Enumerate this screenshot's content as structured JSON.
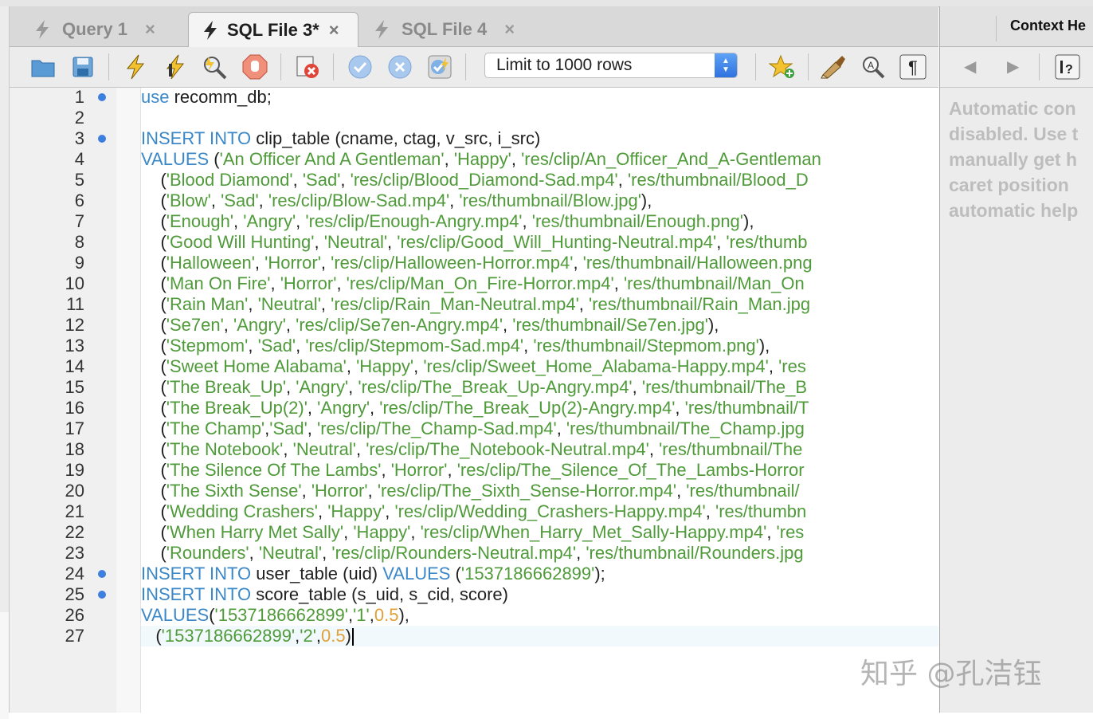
{
  "tabs": [
    {
      "label": "Query 1",
      "active": false
    },
    {
      "label": "SQL File 3*",
      "active": true
    },
    {
      "label": "SQL File 4",
      "active": false
    }
  ],
  "close_glyph": "×",
  "toolbar": {
    "limit_select": "Limit to 1000 rows",
    "icons": [
      "open-folder-icon",
      "save-icon",
      "execute-icon",
      "execute-current-icon",
      "explain-icon",
      "stop-icon",
      "toggle-stop-on-error-icon",
      "commit-icon",
      "rollback-icon",
      "autocommit-icon",
      "add-snippet-icon",
      "beautify-icon",
      "find-icon",
      "invisible-chars-icon"
    ]
  },
  "side_panel": {
    "title": "Context He",
    "message_lines": [
      "Automatic con",
      "disabled. Use t",
      "manually get h",
      "caret position",
      "automatic help"
    ]
  },
  "editor": {
    "lines": [
      {
        "n": "1",
        "dot": true,
        "indent": "",
        "parts": [
          [
            "kw",
            "use"
          ],
          [
            "t",
            " recomm_db;"
          ]
        ]
      },
      {
        "n": "2",
        "dot": false,
        "indent": "",
        "parts": []
      },
      {
        "n": "3",
        "dot": true,
        "indent": "",
        "parts": [
          [
            "kw",
            "INSERT INTO"
          ],
          [
            "t",
            " clip_table (cname, ctag, v_src, i_src)"
          ]
        ]
      },
      {
        "n": "4",
        "dot": false,
        "indent": "",
        "parts": [
          [
            "kw",
            "VALUES"
          ],
          [
            "t",
            " ("
          ],
          [
            "str",
            "'An Officer And A Gentleman'"
          ],
          [
            "t",
            ", "
          ],
          [
            "str",
            "'Happy'"
          ],
          [
            "t",
            ", "
          ],
          [
            "str",
            "'res/clip/An_Officer_And_A-Gentleman"
          ]
        ]
      },
      {
        "n": "5",
        "dot": false,
        "indent": "    ",
        "parts": [
          [
            "t",
            "("
          ],
          [
            "str",
            "'Blood Diamond'"
          ],
          [
            "t",
            ", "
          ],
          [
            "str",
            "'Sad'"
          ],
          [
            "t",
            ", "
          ],
          [
            "str",
            "'res/clip/Blood_Diamond-Sad.mp4'"
          ],
          [
            "t",
            ", "
          ],
          [
            "str",
            "'res/thumbnail/Blood_D"
          ]
        ]
      },
      {
        "n": "6",
        "dot": false,
        "indent": "    ",
        "parts": [
          [
            "t",
            "("
          ],
          [
            "str",
            "'Blow'"
          ],
          [
            "t",
            ", "
          ],
          [
            "str",
            "'Sad'"
          ],
          [
            "t",
            ", "
          ],
          [
            "str",
            "'res/clip/Blow-Sad.mp4'"
          ],
          [
            "t",
            ", "
          ],
          [
            "str",
            "'res/thumbnail/Blow.jpg'"
          ],
          [
            "t",
            "),"
          ]
        ]
      },
      {
        "n": "7",
        "dot": false,
        "indent": "    ",
        "parts": [
          [
            "t",
            "("
          ],
          [
            "str",
            "'Enough'"
          ],
          [
            "t",
            ", "
          ],
          [
            "str",
            "'Angry'"
          ],
          [
            "t",
            ", "
          ],
          [
            "str",
            "'res/clip/Enough-Angry.mp4'"
          ],
          [
            "t",
            ", "
          ],
          [
            "str",
            "'res/thumbnail/Enough.png'"
          ],
          [
            "t",
            "),"
          ]
        ]
      },
      {
        "n": "8",
        "dot": false,
        "indent": "    ",
        "parts": [
          [
            "t",
            "("
          ],
          [
            "str",
            "'Good Will Hunting'"
          ],
          [
            "t",
            ", "
          ],
          [
            "str",
            "'Neutral'"
          ],
          [
            "t",
            ", "
          ],
          [
            "str",
            "'res/clip/Good_Will_Hunting-Neutral.mp4'"
          ],
          [
            "t",
            ", "
          ],
          [
            "str",
            "'res/thumb"
          ]
        ]
      },
      {
        "n": "9",
        "dot": false,
        "indent": "    ",
        "parts": [
          [
            "t",
            "("
          ],
          [
            "str",
            "'Halloween'"
          ],
          [
            "t",
            ", "
          ],
          [
            "str",
            "'Horror'"
          ],
          [
            "t",
            ", "
          ],
          [
            "str",
            "'res/clip/Halloween-Horror.mp4'"
          ],
          [
            "t",
            ", "
          ],
          [
            "str",
            "'res/thumbnail/Halloween.png"
          ]
        ]
      },
      {
        "n": "10",
        "dot": false,
        "indent": "    ",
        "parts": [
          [
            "t",
            "("
          ],
          [
            "str",
            "'Man On Fire'"
          ],
          [
            "t",
            ", "
          ],
          [
            "str",
            "'Horror'"
          ],
          [
            "t",
            ", "
          ],
          [
            "str",
            "'res/clip/Man_On_Fire-Horror.mp4'"
          ],
          [
            "t",
            ", "
          ],
          [
            "str",
            "'res/thumbnail/Man_On"
          ]
        ]
      },
      {
        "n": "11",
        "dot": false,
        "indent": "    ",
        "parts": [
          [
            "t",
            "("
          ],
          [
            "str",
            "'Rain Man'"
          ],
          [
            "t",
            ", "
          ],
          [
            "str",
            "'Neutral'"
          ],
          [
            "t",
            ", "
          ],
          [
            "str",
            "'res/clip/Rain_Man-Neutral.mp4'"
          ],
          [
            "t",
            ", "
          ],
          [
            "str",
            "'res/thumbnail/Rain_Man.jpg"
          ]
        ]
      },
      {
        "n": "12",
        "dot": false,
        "indent": "    ",
        "parts": [
          [
            "t",
            "("
          ],
          [
            "str",
            "'Se7en'"
          ],
          [
            "t",
            ", "
          ],
          [
            "str",
            "'Angry'"
          ],
          [
            "t",
            ", "
          ],
          [
            "str",
            "'res/clip/Se7en-Angry.mp4'"
          ],
          [
            "t",
            ", "
          ],
          [
            "str",
            "'res/thumbnail/Se7en.jpg'"
          ],
          [
            "t",
            "),"
          ]
        ]
      },
      {
        "n": "13",
        "dot": false,
        "indent": "    ",
        "parts": [
          [
            "t",
            "("
          ],
          [
            "str",
            "'Stepmom'"
          ],
          [
            "t",
            ", "
          ],
          [
            "str",
            "'Sad'"
          ],
          [
            "t",
            ", "
          ],
          [
            "str",
            "'res/clip/Stepmom-Sad.mp4'"
          ],
          [
            "t",
            ", "
          ],
          [
            "str",
            "'res/thumbnail/Stepmom.png'"
          ],
          [
            "t",
            "),"
          ]
        ]
      },
      {
        "n": "14",
        "dot": false,
        "indent": "    ",
        "parts": [
          [
            "t",
            "("
          ],
          [
            "str",
            "'Sweet Home Alabama'"
          ],
          [
            "t",
            ", "
          ],
          [
            "str",
            "'Happy'"
          ],
          [
            "t",
            ", "
          ],
          [
            "str",
            "'res/clip/Sweet_Home_Alabama-Happy.mp4'"
          ],
          [
            "t",
            ", "
          ],
          [
            "str",
            "'res"
          ]
        ]
      },
      {
        "n": "15",
        "dot": false,
        "indent": "    ",
        "parts": [
          [
            "t",
            "("
          ],
          [
            "str",
            "'The Break_Up'"
          ],
          [
            "t",
            ", "
          ],
          [
            "str",
            "'Angry'"
          ],
          [
            "t",
            ", "
          ],
          [
            "str",
            "'res/clip/The_Break_Up-Angry.mp4'"
          ],
          [
            "t",
            ", "
          ],
          [
            "str",
            "'res/thumbnail/The_B"
          ]
        ]
      },
      {
        "n": "16",
        "dot": false,
        "indent": "    ",
        "parts": [
          [
            "t",
            "("
          ],
          [
            "str",
            "'The Break_Up(2)'"
          ],
          [
            "t",
            ", "
          ],
          [
            "str",
            "'Angry'"
          ],
          [
            "t",
            ", "
          ],
          [
            "str",
            "'res/clip/The_Break_Up(2)-Angry.mp4'"
          ],
          [
            "t",
            ", "
          ],
          [
            "str",
            "'res/thumbnail/T"
          ]
        ]
      },
      {
        "n": "17",
        "dot": false,
        "indent": "    ",
        "parts": [
          [
            "t",
            "("
          ],
          [
            "str",
            "'The Champ'"
          ],
          [
            "t",
            ","
          ],
          [
            "str",
            "'Sad'"
          ],
          [
            "t",
            ", "
          ],
          [
            "str",
            "'res/clip/The_Champ-Sad.mp4'"
          ],
          [
            "t",
            ", "
          ],
          [
            "str",
            "'res/thumbnail/The_Champ.jpg"
          ]
        ]
      },
      {
        "n": "18",
        "dot": false,
        "indent": "    ",
        "parts": [
          [
            "t",
            "("
          ],
          [
            "str",
            "'The Notebook'"
          ],
          [
            "t",
            ", "
          ],
          [
            "str",
            "'Neutral'"
          ],
          [
            "t",
            ", "
          ],
          [
            "str",
            "'res/clip/The_Notebook-Neutral.mp4'"
          ],
          [
            "t",
            ", "
          ],
          [
            "str",
            "'res/thumbnail/The"
          ]
        ]
      },
      {
        "n": "19",
        "dot": false,
        "indent": "    ",
        "parts": [
          [
            "t",
            "("
          ],
          [
            "str",
            "'The Silence Of The Lambs'"
          ],
          [
            "t",
            ", "
          ],
          [
            "str",
            "'Horror'"
          ],
          [
            "t",
            ", "
          ],
          [
            "str",
            "'res/clip/The_Silence_Of_The_Lambs-Horror"
          ]
        ]
      },
      {
        "n": "20",
        "dot": false,
        "indent": "    ",
        "parts": [
          [
            "t",
            "("
          ],
          [
            "str",
            "'The Sixth Sense'"
          ],
          [
            "t",
            ", "
          ],
          [
            "str",
            "'Horror'"
          ],
          [
            "t",
            ", "
          ],
          [
            "str",
            "'res/clip/The_Sixth_Sense-Horror.mp4'"
          ],
          [
            "t",
            ", "
          ],
          [
            "str",
            "'res/thumbnail/"
          ]
        ]
      },
      {
        "n": "21",
        "dot": false,
        "indent": "    ",
        "parts": [
          [
            "t",
            "("
          ],
          [
            "str",
            "'Wedding Crashers'"
          ],
          [
            "t",
            ", "
          ],
          [
            "str",
            "'Happy'"
          ],
          [
            "t",
            ", "
          ],
          [
            "str",
            "'res/clip/Wedding_Crashers-Happy.mp4'"
          ],
          [
            "t",
            ", "
          ],
          [
            "str",
            "'res/thumbn"
          ]
        ]
      },
      {
        "n": "22",
        "dot": false,
        "indent": "    ",
        "parts": [
          [
            "t",
            "("
          ],
          [
            "str",
            "'When Harry Met Sally'"
          ],
          [
            "t",
            ", "
          ],
          [
            "str",
            "'Happy'"
          ],
          [
            "t",
            ", "
          ],
          [
            "str",
            "'res/clip/When_Harry_Met_Sally-Happy.mp4'"
          ],
          [
            "t",
            ", "
          ],
          [
            "str",
            "'res"
          ]
        ]
      },
      {
        "n": "23",
        "dot": false,
        "indent": "    ",
        "parts": [
          [
            "t",
            "("
          ],
          [
            "str",
            "'Rounders'"
          ],
          [
            "t",
            ", "
          ],
          [
            "str",
            "'Neutral'"
          ],
          [
            "t",
            ", "
          ],
          [
            "str",
            "'res/clip/Rounders-Neutral.mp4'"
          ],
          [
            "t",
            ", "
          ],
          [
            "str",
            "'res/thumbnail/Rounders.jpg"
          ]
        ]
      },
      {
        "n": "24",
        "dot": true,
        "indent": "",
        "parts": [
          [
            "kw",
            "INSERT INTO"
          ],
          [
            "t",
            " user_table (uid) "
          ],
          [
            "kw",
            "VALUES"
          ],
          [
            "t",
            " ("
          ],
          [
            "str",
            "'1537186662899'"
          ],
          [
            "t",
            ");"
          ]
        ]
      },
      {
        "n": "25",
        "dot": true,
        "indent": "",
        "parts": [
          [
            "kw",
            "INSERT INTO"
          ],
          [
            "t",
            " score_table (s_uid, s_cid, score)"
          ]
        ]
      },
      {
        "n": "26",
        "dot": false,
        "indent": "",
        "parts": [
          [
            "kw",
            "VALUES"
          ],
          [
            "t",
            "("
          ],
          [
            "str",
            "'1537186662899'"
          ],
          [
            "t",
            ","
          ],
          [
            "str",
            "'1'"
          ],
          [
            "t",
            ","
          ],
          [
            "num",
            "0.5"
          ],
          [
            "t",
            "),"
          ]
        ]
      },
      {
        "n": "27",
        "dot": false,
        "indent": "   ",
        "current": true,
        "parts": [
          [
            "t",
            "("
          ],
          [
            "str",
            "'1537186662899'"
          ],
          [
            "t",
            ","
          ],
          [
            "str",
            "'2'"
          ],
          [
            "t",
            ","
          ],
          [
            "num",
            "0.5"
          ],
          [
            "t",
            ")"
          ]
        ]
      }
    ]
  },
  "watermark": "知乎 @孔洁钰"
}
